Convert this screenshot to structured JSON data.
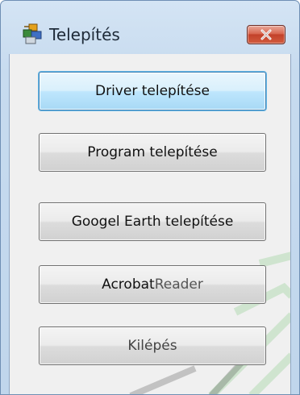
{
  "window": {
    "title": "Telepítés",
    "icon": "installer-icon",
    "close_icon": "close-icon"
  },
  "buttons": [
    {
      "label": "Driver telepítése",
      "state": "focused"
    },
    {
      "label": "Program telepítése",
      "state": "normal"
    },
    {
      "label": "Googel Earth telepítése",
      "state": "normal"
    },
    {
      "label_part1": "Acrobat",
      "label_part2": " Reader",
      "state": "normal"
    },
    {
      "label": "Kilépés",
      "state": "normal"
    }
  ],
  "colors": {
    "titlebar": "#c7dbef",
    "close_button": "#c2412a",
    "focused_button": "#bee6fd",
    "client_background": "#f0f0f0"
  }
}
